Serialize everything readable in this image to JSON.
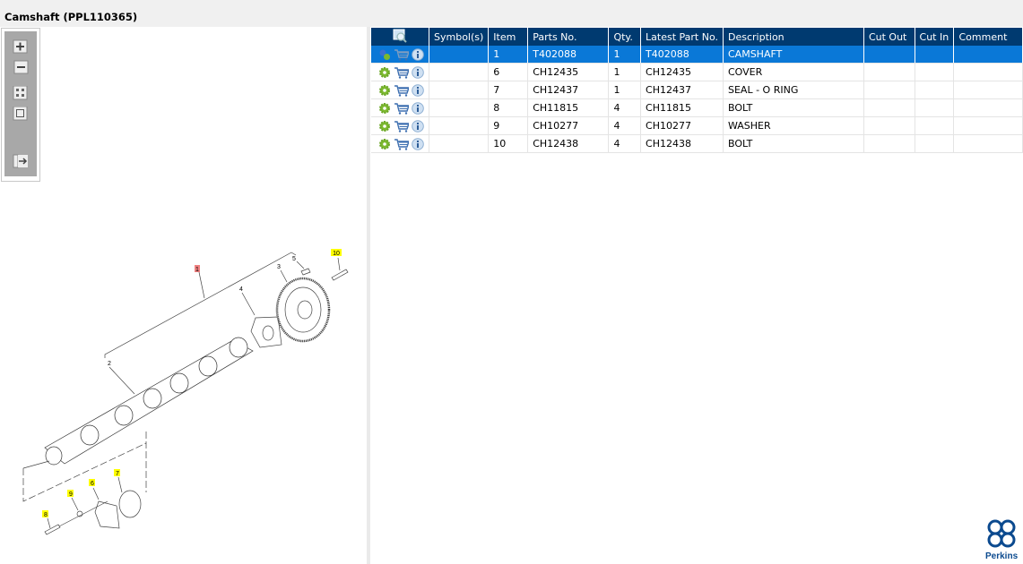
{
  "window": {
    "title": "Camshaft (PPL110365)"
  },
  "toolbar": {
    "buttons": [
      {
        "name": "zoom-in",
        "icon": "plus-icon"
      },
      {
        "name": "zoom-out",
        "icon": "minus-icon"
      },
      {
        "name": "fit-all",
        "icon": "grid-icon"
      },
      {
        "name": "fit-window",
        "icon": "square-icon"
      },
      {
        "name": "export",
        "icon": "arrow-right-icon"
      }
    ]
  },
  "diagram": {
    "callouts": [
      {
        "label": "1",
        "highlight": "red"
      },
      {
        "label": "2",
        "highlight": "none"
      },
      {
        "label": "3",
        "highlight": "none"
      },
      {
        "label": "4",
        "highlight": "none"
      },
      {
        "label": "5",
        "highlight": "none"
      },
      {
        "label": "6",
        "highlight": "yellow"
      },
      {
        "label": "7",
        "highlight": "yellow"
      },
      {
        "label": "8",
        "highlight": "yellow"
      },
      {
        "label": "9",
        "highlight": "yellow"
      },
      {
        "label": "10",
        "highlight": "yellow"
      }
    ]
  },
  "table": {
    "columns": [
      "",
      "Symbol(s)",
      "Item",
      "Parts No.",
      "Qty.",
      "Latest Part No.",
      "Description",
      "Cut Out",
      "Cut In",
      "Comment"
    ],
    "rows": [
      {
        "selected": true,
        "symbols": "",
        "item": "1",
        "part": "T402088",
        "qty": "1",
        "latest": "T402088",
        "desc": "CAMSHAFT",
        "cut_out": "",
        "cut_in": "",
        "comment": ""
      },
      {
        "selected": false,
        "symbols": "",
        "item": "6",
        "part": "CH12435",
        "qty": "1",
        "latest": "CH12435",
        "desc": "COVER",
        "cut_out": "",
        "cut_in": "",
        "comment": ""
      },
      {
        "selected": false,
        "symbols": "",
        "item": "7",
        "part": "CH12437",
        "qty": "1",
        "latest": "CH12437",
        "desc": "SEAL - O RING",
        "cut_out": "",
        "cut_in": "",
        "comment": ""
      },
      {
        "selected": false,
        "symbols": "",
        "item": "8",
        "part": "CH11815",
        "qty": "4",
        "latest": "CH11815",
        "desc": "BOLT",
        "cut_out": "",
        "cut_in": "",
        "comment": ""
      },
      {
        "selected": false,
        "symbols": "",
        "item": "9",
        "part": "CH10277",
        "qty": "4",
        "latest": "CH10277",
        "desc": "WASHER",
        "cut_out": "",
        "cut_in": "",
        "comment": ""
      },
      {
        "selected": false,
        "symbols": "",
        "item": "10",
        "part": "CH12438",
        "qty": "4",
        "latest": "CH12438",
        "desc": "BOLT",
        "cut_out": "",
        "cut_in": "",
        "comment": ""
      }
    ]
  },
  "brand": {
    "name": "Perkins",
    "color": "#0b4a8f"
  },
  "colors": {
    "header": "#003a70",
    "selected": "#0a78d7",
    "highlight_yellow": "#ffff00",
    "highlight_red": "#f08080"
  }
}
